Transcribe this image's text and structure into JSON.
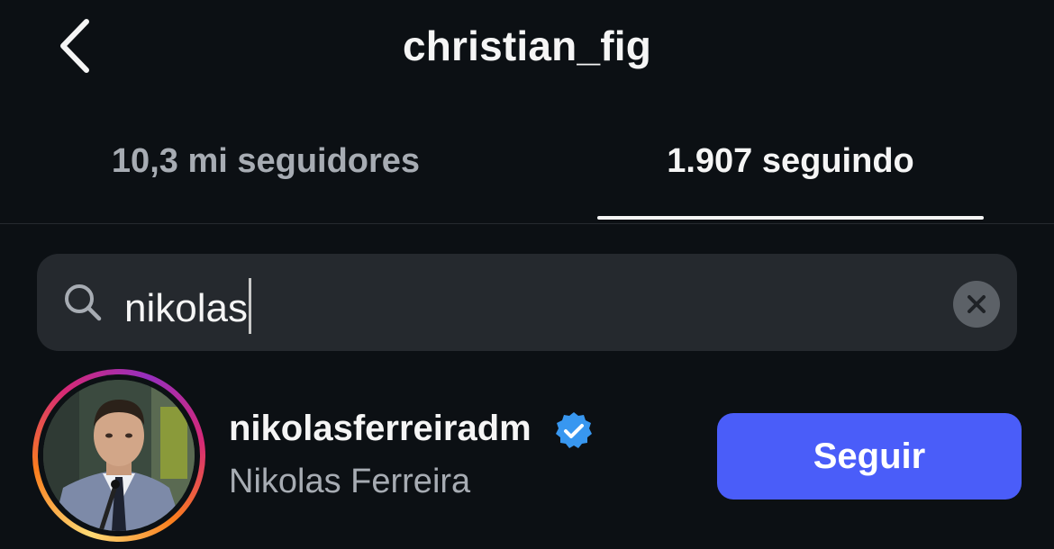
{
  "header": {
    "title": "christian_fig",
    "back_icon": "chevron-left-icon"
  },
  "tabs": [
    {
      "label": "10,3 mi seguidores",
      "active": false
    },
    {
      "label": "1.907 seguindo",
      "active": true
    }
  ],
  "search": {
    "icon": "search-icon",
    "value": "nikolas",
    "clear_icon": "close-icon"
  },
  "results": [
    {
      "username": "nikolasferreiradm",
      "full_name": "Nikolas Ferreira",
      "verified": true,
      "has_story_ring": true,
      "button_label": "Seguir"
    }
  ],
  "colors": {
    "background": "#0c1014",
    "primary_text": "#f5f5f5",
    "secondary_text": "#a7acb3",
    "search_bg": "#25292e",
    "follow_button": "#4a5df9",
    "verified_badge": "#3897f0"
  }
}
